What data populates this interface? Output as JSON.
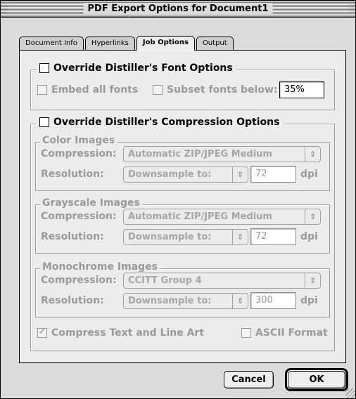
{
  "window": {
    "title": "PDF Export Options for Document1"
  },
  "tabs": [
    {
      "label": "Document Info",
      "active": false
    },
    {
      "label": "Hyperlinks",
      "active": false
    },
    {
      "label": "Job Options",
      "active": true
    },
    {
      "label": "Output",
      "active": false
    }
  ],
  "font_options": {
    "override_label": "Override Distiller's Font Options",
    "override_checked": false,
    "embed_label": "Embed all fonts",
    "embed_checked": false,
    "subset_label": "Subset fonts below:",
    "subset_checked": false,
    "subset_value": "35%"
  },
  "compression": {
    "override_label": "Override Distiller's Compression Options",
    "override_checked": false,
    "labels": {
      "compression": "Compression:",
      "resolution": "Resolution:",
      "dpi": "dpi"
    },
    "color": {
      "title": "Color Images",
      "compression_value": "Automatic ZIP/JPEG Medium",
      "resolution_value": "Downsample to:",
      "dpi_value": "72"
    },
    "grayscale": {
      "title": "Grayscale Images",
      "compression_value": "Automatic ZIP/JPEG Medium",
      "resolution_value": "Downsample to:",
      "dpi_value": "72"
    },
    "monochrome": {
      "title": "Monochrome Images",
      "compression_value": "CCITT Group 4",
      "resolution_value": "Downsample to:",
      "dpi_value": "300"
    },
    "compress_text_label": "Compress Text and Line Art",
    "compress_text_checked": true,
    "ascii_label": "ASCII Format",
    "ascii_checked": false
  },
  "buttons": {
    "cancel": "Cancel",
    "ok": "OK"
  },
  "icons": {
    "checkmark": "✓",
    "popup_arrows": "⇕"
  }
}
